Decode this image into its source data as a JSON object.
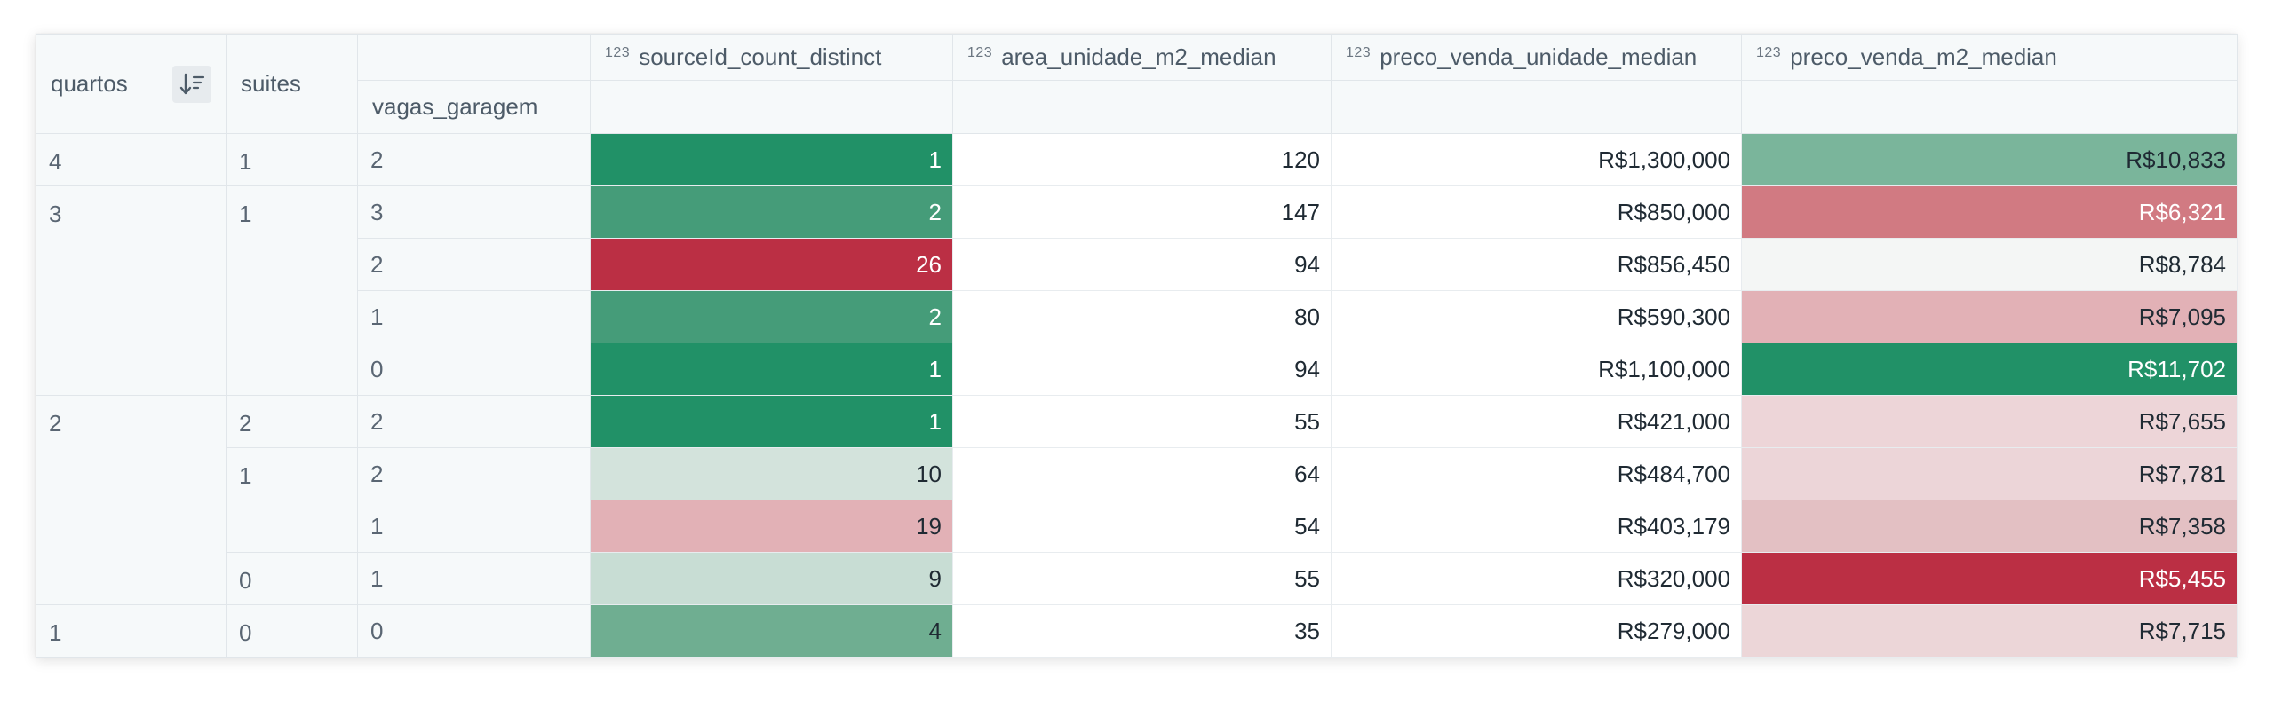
{
  "columns": {
    "quartos": "quartos",
    "suites": "suites",
    "vagas_garagem": "vagas_garagem",
    "metric_type_glyph": "123",
    "metrics": [
      "sourceId_count_distinct",
      "area_unidade_m2_median",
      "preco_venda_unidade_median",
      "preco_venda_m2_median"
    ]
  },
  "sort_icon": "sort-descending-icon",
  "groups": [
    {
      "quartos": "4",
      "suites": [
        {
          "suites": "1",
          "rows": [
            {
              "vagas": "2",
              "count": "1",
              "area": "120",
              "preco": "R$1,300,000",
              "m2": "R$10,833"
            }
          ]
        }
      ]
    },
    {
      "quartos": "3",
      "suites": [
        {
          "suites": "1",
          "rows": [
            {
              "vagas": "3",
              "count": "2",
              "area": "147",
              "preco": "R$850,000",
              "m2": "R$6,321"
            },
            {
              "vagas": "2",
              "count": "26",
              "area": "94",
              "preco": "R$856,450",
              "m2": "R$8,784"
            },
            {
              "vagas": "1",
              "count": "2",
              "area": "80",
              "preco": "R$590,300",
              "m2": "R$7,095"
            },
            {
              "vagas": "0",
              "count": "1",
              "area": "94",
              "preco": "R$1,100,000",
              "m2": "R$11,702"
            }
          ]
        }
      ]
    },
    {
      "quartos": "2",
      "suites": [
        {
          "suites": "2",
          "rows": [
            {
              "vagas": "2",
              "count": "1",
              "area": "55",
              "preco": "R$421,000",
              "m2": "R$7,655"
            }
          ]
        },
        {
          "suites": "1",
          "rows": [
            {
              "vagas": "2",
              "count": "10",
              "area": "64",
              "preco": "R$484,700",
              "m2": "R$7,781"
            },
            {
              "vagas": "1",
              "count": "19",
              "area": "54",
              "preco": "R$403,179",
              "m2": "R$7,358"
            }
          ]
        },
        {
          "suites": "0",
          "rows": [
            {
              "vagas": "1",
              "count": "9",
              "area": "55",
              "preco": "R$320,000",
              "m2": "R$5,455"
            }
          ]
        }
      ]
    },
    {
      "quartos": "1",
      "suites": [
        {
          "suites": "0",
          "rows": [
            {
              "vagas": "0",
              "count": "4",
              "area": "35",
              "preco": "R$279,000",
              "m2": "R$7,715"
            }
          ]
        }
      ]
    }
  ],
  "heat_colors": {
    "count": [
      "#219167",
      "#459c79",
      "#bb2f44",
      "#459c79",
      "#219167",
      "#219167",
      "#d3e3dc",
      "#e2b1b6",
      "#c8ddd4",
      "#6fae91"
    ],
    "m2": [
      "#7ab59b",
      "#d17a82",
      "#f4f6f5",
      "#e2b1b6",
      "#219167",
      "#edd5d8",
      "#ecd5d8",
      "#e3c0c3",
      "#bb2f44",
      "#ecd6d8"
    ],
    "count_text": [
      "light",
      "light",
      "light",
      "light",
      "light",
      "light",
      "dark",
      "dark",
      "dark",
      "dark"
    ],
    "m2_text": [
      "dark",
      "light",
      "dark",
      "dark",
      "light",
      "dark",
      "dark",
      "dark",
      "light",
      "dark"
    ]
  }
}
